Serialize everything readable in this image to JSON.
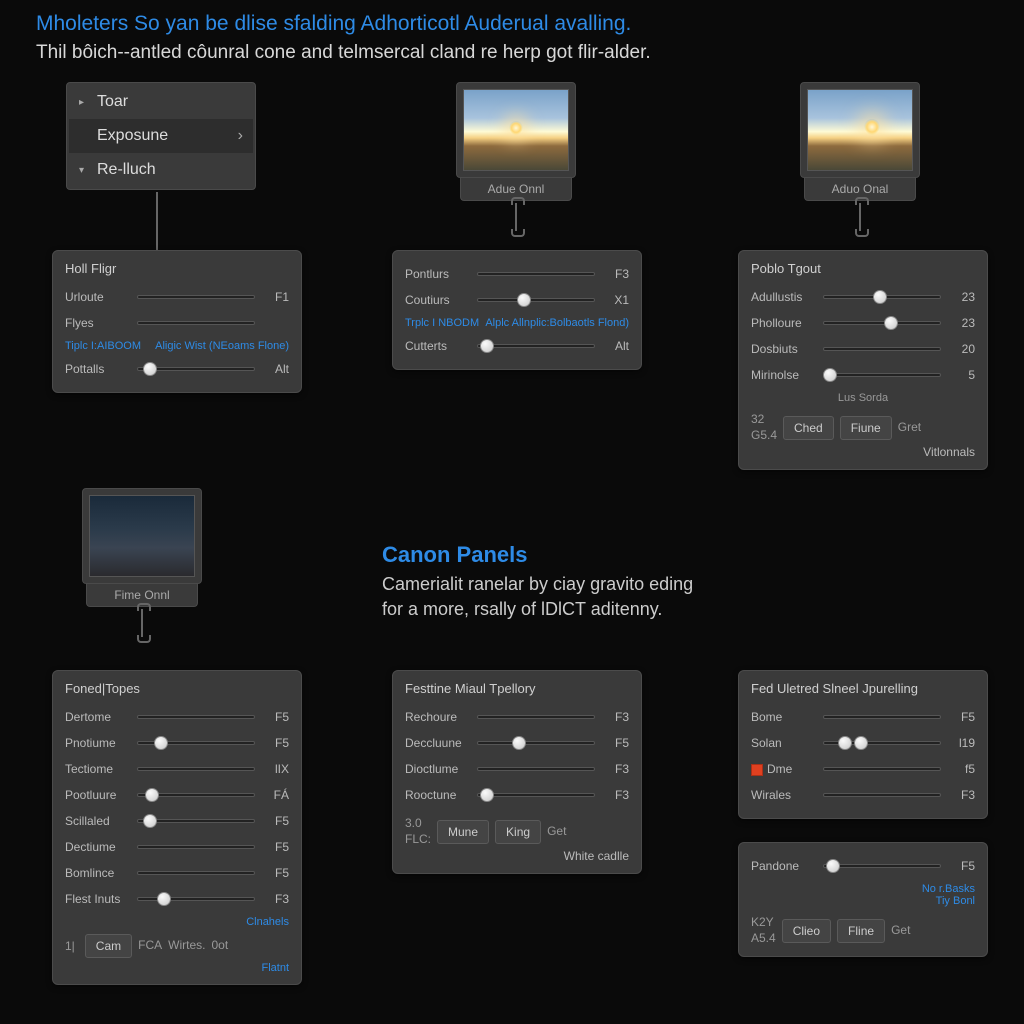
{
  "header": {
    "title": "Mholeters So yan be dlise sfalding Adhorticotl Auderual avalling.",
    "subtitle": "Thil bôich--antled côunral cone and telmsercal cland re herp got flir-alder."
  },
  "nav": {
    "items": [
      {
        "label": "Toar",
        "icon": "▸"
      },
      {
        "label": "Exposune",
        "icon": "",
        "chevron": "›",
        "selected": true
      },
      {
        "label": "Re-lluch",
        "icon": "▾"
      }
    ]
  },
  "thumbs": {
    "t1": {
      "caption": "Adue Onnl"
    },
    "t2": {
      "caption": "Aduo Onal"
    },
    "t3": {
      "caption": "Fime Onnl"
    }
  },
  "panels": {
    "p1": {
      "title": "Holl Fligr",
      "sliders": [
        {
          "label": "Urloute",
          "val": "F1",
          "pos": 0
        },
        {
          "label": "Flyes",
          "val": "",
          "pos": 0
        },
        {
          "label": "Pottalls",
          "val": "Alt",
          "pos": 10
        }
      ],
      "links": {
        "left": "Tiplc I:AIBOOM",
        "right": "Aligic Wist (NEoams Flone)"
      }
    },
    "p2": {
      "title": "",
      "sliders": [
        {
          "label": "Pontlurs",
          "val": "F3",
          "pos": 0
        },
        {
          "label": "Coutiurs",
          "val": "X1",
          "pos": 40
        },
        {
          "label": "Cutterts",
          "val": "Alt",
          "pos": 8
        }
      ],
      "links": {
        "left": "Trplc I NBODM",
        "right": "Alplc Allnplic:Bolbaotls Flond)"
      }
    },
    "p3": {
      "title": "Poblo Tgout",
      "sliders": [
        {
          "label": "Adullustis",
          "val": "23",
          "pos": 48
        },
        {
          "label": "Pholloure",
          "val": "23",
          "pos": 58
        },
        {
          "label": "Dosbiuts",
          "val": "20",
          "pos": 100
        },
        {
          "label": "Mirinolse",
          "val": "5",
          "pos": 5
        }
      ],
      "sub": "Lus Sorda",
      "meta": {
        "l1": "32",
        "l2": "G5.4"
      },
      "buttons": [
        "Ched",
        "Fiune",
        "Gret"
      ],
      "foot": "Vitlonnals"
    },
    "p4": {
      "title": "Foned|Topes",
      "sliders": [
        {
          "label": "Dertome",
          "val": "F5",
          "pos": 0
        },
        {
          "label": "Pnotiume",
          "val": "F5",
          "pos": 20
        },
        {
          "label": "Tectiome",
          "val": "lIX",
          "pos": 0
        },
        {
          "label": "Pootluure",
          "val": "FÁ",
          "pos": 12
        },
        {
          "label": "Scillaled",
          "val": "F5",
          "pos": 10
        },
        {
          "label": "Dectiume",
          "val": "F5",
          "pos": 0
        },
        {
          "label": "Bomlince",
          "val": "F5",
          "pos": 0
        },
        {
          "label": "Flest Inuts",
          "val": "F3",
          "pos": 22
        }
      ],
      "link": "Clnahels",
      "footer": {
        "num": "1|",
        "buttons": [
          "Cam",
          "FCA",
          "Wirtes.",
          "0ot"
        ],
        "link": "Flatnt"
      }
    },
    "p5": {
      "title": "Festtine Miaul Tpellory",
      "sliders": [
        {
          "label": "Rechoure",
          "val": "F3",
          "pos": 0
        },
        {
          "label": "Deccluune",
          "val": "F5",
          "pos": 35
        },
        {
          "label": "Dioctlume",
          "val": "F3",
          "pos": 0
        },
        {
          "label": "Rooctune",
          "val": "F3",
          "pos": 8
        }
      ],
      "meta": {
        "l1": "3.0",
        "l2": "FLC:"
      },
      "buttons": [
        "Mune",
        "King",
        "Get"
      ],
      "foot": "White cadlle"
    },
    "p6": {
      "title": "Fed Uletred Slneel Jpurelling",
      "sliders": [
        {
          "label": "Bome",
          "val": "F5",
          "pos": 0
        },
        {
          "label": "Solan",
          "val": "l19",
          "pos": 30,
          "dot": true
        },
        {
          "label": "Dme",
          "val": "f5",
          "pos": 0,
          "swatch": true,
          "red": true
        },
        {
          "label": "Wirales",
          "val": "F3",
          "pos": 0
        }
      ]
    },
    "p7": {
      "title": "",
      "sliders": [
        {
          "label": "Pandone",
          "val": "F5",
          "pos": 8
        }
      ],
      "link2": "No r.Basks\nTiy Bonl",
      "meta": {
        "l1": "K2Y",
        "l2": "A5.4"
      },
      "buttons": [
        "Clieo",
        "Fline",
        "Get"
      ]
    }
  },
  "section2": {
    "title": "Canon Panels",
    "sub": "Camerialit ranelar by ciay gravito eding\nfor a more, rsally of lDlCT aditenny."
  }
}
